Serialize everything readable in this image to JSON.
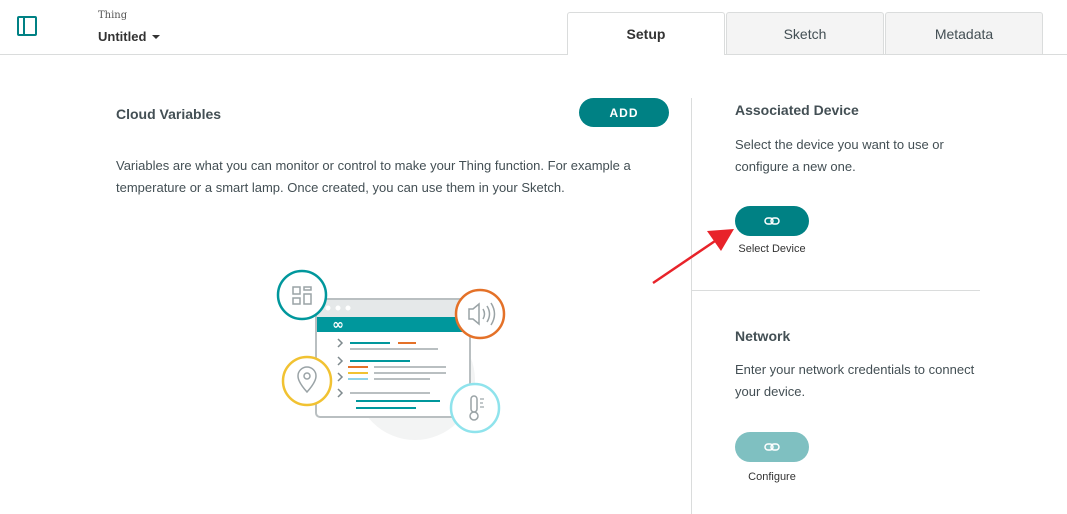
{
  "header": {
    "thing_label": "Thing",
    "thing_name": "Untitled",
    "tabs": [
      {
        "label": "Setup",
        "active": true
      },
      {
        "label": "Sketch",
        "active": false
      },
      {
        "label": "Metadata",
        "active": false
      }
    ]
  },
  "cloud_variables": {
    "title": "Cloud Variables",
    "add_label": "ADD",
    "description": "Variables are what you can monitor or control to make your Thing function. For example a temperature or a smart lamp. Once created, you can use them in your Sketch."
  },
  "associated_device": {
    "title": "Associated Device",
    "description": "Select the device you want to use or configure a new one.",
    "button_label": "Select Device",
    "button_icon": "link-icon"
  },
  "network": {
    "title": "Network",
    "description": "Enter your network credentials to connect your device.",
    "button_label": "Configure",
    "button_icon": "link-icon"
  },
  "colors": {
    "teal": "#008184",
    "teal_disabled": "#7fc0c1",
    "annotation_arrow": "#e8232a"
  }
}
